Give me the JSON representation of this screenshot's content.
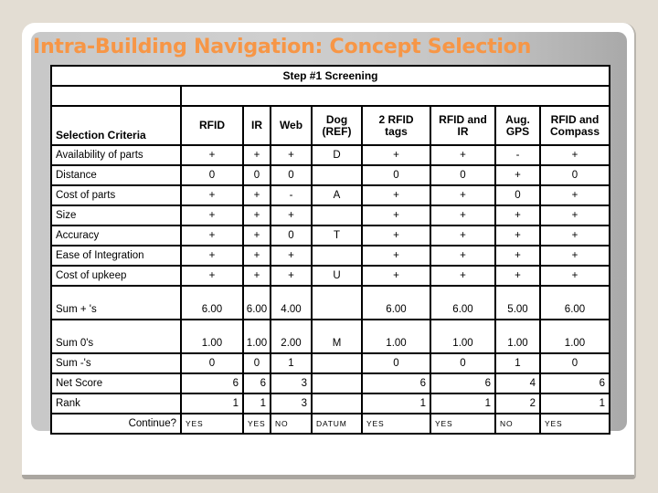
{
  "slide": {
    "title": "Intra-Building Navigation: Concept Selection"
  },
  "table": {
    "caption": "Step #1 Screening",
    "criteria_header": "Selection Criteria",
    "concepts": [
      "RFID",
      "IR",
      "Web",
      "Dog (REF)",
      "2 RFID tags",
      "RFID and IR",
      "Aug. GPS",
      "RFID and Compass"
    ],
    "criteria": [
      {
        "name": "Availability of parts",
        "values": [
          "+",
          "+",
          "+",
          "D",
          "+",
          "+",
          "-",
          "+"
        ]
      },
      {
        "name": "Distance",
        "values": [
          "0",
          "0",
          "0",
          "",
          "0",
          "0",
          "+",
          "0"
        ]
      },
      {
        "name": "Cost of parts",
        "values": [
          "+",
          "+",
          "-",
          "A",
          "+",
          "+",
          "0",
          "+"
        ]
      },
      {
        "name": "Size",
        "values": [
          "+",
          "+",
          "+",
          "",
          "+",
          "+",
          "+",
          "+"
        ]
      },
      {
        "name": "Accuracy",
        "values": [
          "+",
          "+",
          "0",
          "T",
          "+",
          "+",
          "+",
          "+"
        ]
      },
      {
        "name": "Ease of Integration",
        "values": [
          "+",
          "+",
          "+",
          "",
          "+",
          "+",
          "+",
          "+"
        ]
      },
      {
        "name": "Cost of upkeep",
        "values": [
          "+",
          "+",
          "+",
          "U",
          "+",
          "+",
          "+",
          "+"
        ]
      }
    ],
    "summary": [
      {
        "name": "Sum + 's",
        "values": [
          "6.00",
          "6.00",
          "4.00",
          "",
          "6.00",
          "6.00",
          "5.00",
          "6.00"
        ]
      },
      {
        "name": "Sum 0's",
        "values": [
          "1.00",
          "1.00",
          "2.00",
          "M",
          "1.00",
          "1.00",
          "1.00",
          "1.00"
        ]
      },
      {
        "name": "Sum -'s",
        "values": [
          "0",
          "0",
          "1",
          "",
          "0",
          "0",
          "1",
          "0"
        ]
      },
      {
        "name": "Net Score",
        "values": [
          "6",
          "6",
          "3",
          "",
          "6",
          "6",
          "4",
          "6"
        ]
      },
      {
        "name": "Rank",
        "values": [
          "1",
          "1",
          "3",
          "",
          "1",
          "1",
          "2",
          "1"
        ]
      }
    ],
    "continue_label": "Continue?",
    "continue_values": [
      "YES",
      "YES",
      "NO",
      "DATUM",
      "YES",
      "YES",
      "NO",
      "YES"
    ]
  }
}
